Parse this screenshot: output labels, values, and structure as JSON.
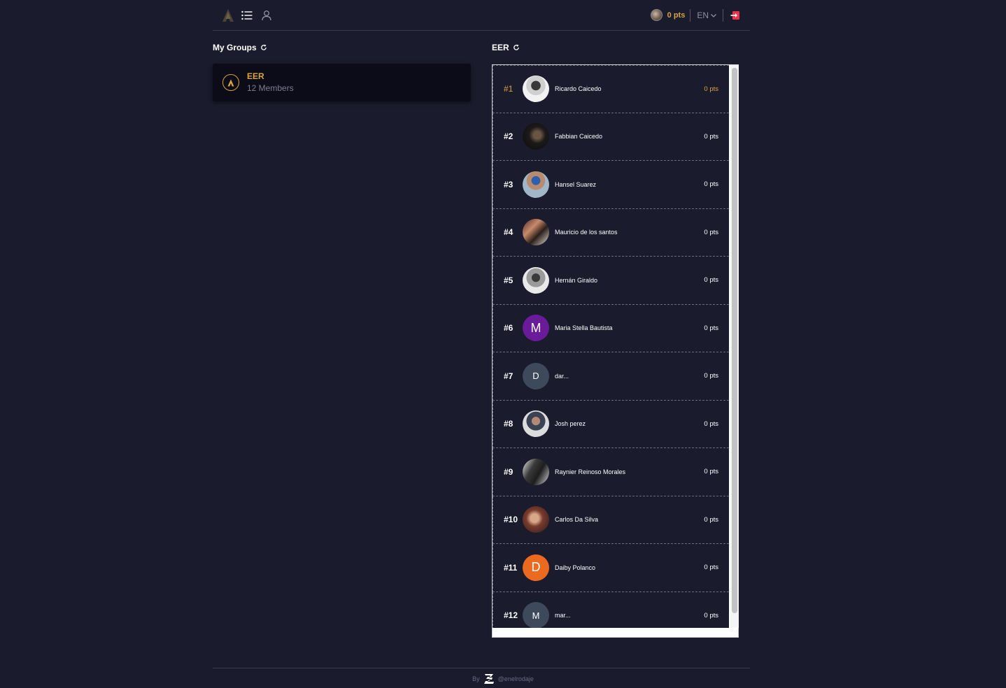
{
  "header": {
    "user_points": "0 pts",
    "language": "EN"
  },
  "my_groups": {
    "title": "My Groups",
    "groups": [
      {
        "name": "EER",
        "members": "12 Members"
      }
    ]
  },
  "leaderboard": {
    "title": "EER",
    "rows": [
      {
        "rank": "#1",
        "name": "Ricardo Caicedo",
        "points": "0 pts"
      },
      {
        "rank": "#2",
        "name": "Fabbian Caicedo",
        "points": "0 pts"
      },
      {
        "rank": "#3",
        "name": "Hansel Suarez",
        "points": "0 pts"
      },
      {
        "rank": "#4",
        "name": "Mauricio de los santos",
        "points": "0 pts"
      },
      {
        "rank": "#5",
        "name": "Hernán Giraldo",
        "points": "0 pts"
      },
      {
        "rank": "#6",
        "name": "Maria Stella Bautista",
        "points": "0 pts",
        "initial": "M"
      },
      {
        "rank": "#7",
        "name": "dar...",
        "points": "0 pts",
        "initial": "D"
      },
      {
        "rank": "#8",
        "name": "Josh perez",
        "points": "0 pts"
      },
      {
        "rank": "#9",
        "name": "Raynier Reinoso Morales",
        "points": "0 pts"
      },
      {
        "rank": "#10",
        "name": "Carlos Da Silva",
        "points": "0 pts"
      },
      {
        "rank": "#11",
        "name": "Daiby Polanco",
        "points": "0 pts",
        "initial": "D"
      },
      {
        "rank": "#12",
        "name": "mar...",
        "points": "0 pts",
        "initial": "M"
      }
    ]
  },
  "footer": {
    "by": "By",
    "handle": "@enelrodaje"
  },
  "colors": {
    "background": "#1a1b2c",
    "accent_gold": "#d9a441",
    "logout_red": "#e8334a",
    "avatar_purple": "#6a1b9a",
    "avatar_orange": "#ec6a1f",
    "avatar_slate": "#3e4a5c"
  }
}
